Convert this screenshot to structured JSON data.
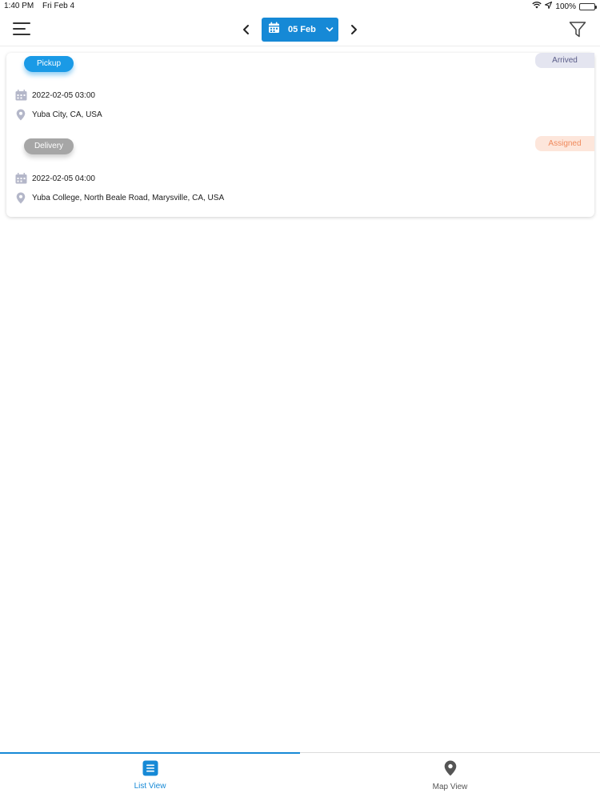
{
  "status_bar": {
    "time": "1:40 PM",
    "date": "Fri Feb 4",
    "battery": "100%"
  },
  "header": {
    "selected_date": "05 Feb"
  },
  "order": {
    "pickup": {
      "type_label": "Pickup",
      "status": "Arrived",
      "datetime": "2022-02-05 03:00",
      "location": "Yuba City, CA, USA"
    },
    "delivery": {
      "type_label": "Delivery",
      "status": "Assigned",
      "datetime": "2022-02-05 04:00",
      "location": "Yuba College, North Beale Road, Marysville, CA, USA"
    }
  },
  "bottom_tabs": {
    "list_label": "List View",
    "map_label": "Map View",
    "active": "List View"
  },
  "colors": {
    "accent": "#1689d6",
    "pickup_badge": "#1a9ae6",
    "delivery_badge": "#a6a6a6",
    "arrived_bg": "#e4e5f0",
    "assigned_bg": "#fde6db"
  }
}
